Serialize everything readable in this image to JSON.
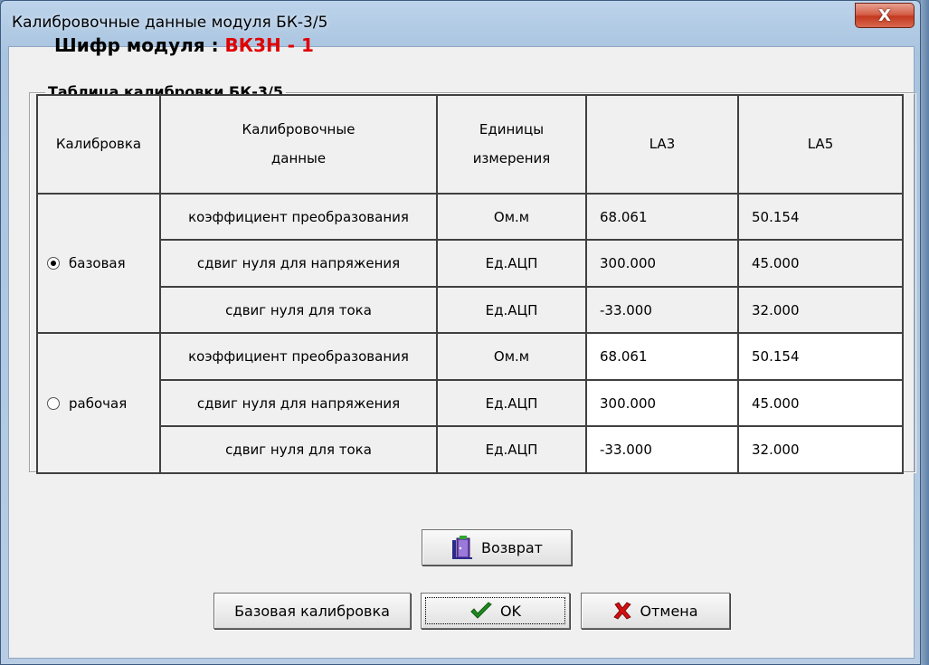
{
  "window": {
    "title": "Калибровочные данные модуля БК-3/5",
    "close_glyph": "X"
  },
  "cipher": {
    "label": "Шифр модуля : ",
    "value": "ВК3Н - 1",
    "value_color": "#e00000"
  },
  "group": {
    "title": "Таблица калибровки БК-3/5"
  },
  "table": {
    "headers": {
      "calibration": "Калибровка",
      "data_line1": "Калибровочные",
      "data_line2": "данные",
      "units_line1": "Единицы",
      "units_line2": "измерения",
      "la3": "LA3",
      "la5": "LA5"
    },
    "groups": [
      {
        "radio_label": "базовая",
        "selected": true,
        "rows": [
          {
            "name": "коэффициент преобразования",
            "unit": "Ом.м",
            "la3": "68.061",
            "la5": "50.154"
          },
          {
            "name": "сдвиг нуля для напряжения",
            "unit": "Ед.АЦП",
            "la3": "300.000",
            "la5": "45.000"
          },
          {
            "name": "сдвиг нуля для тока",
            "unit": "Ед.АЦП",
            "la3": "-33.000",
            "la5": "32.000"
          }
        ]
      },
      {
        "radio_label": "рабочая",
        "selected": false,
        "rows": [
          {
            "name": "коэффициент преобразования",
            "unit": "Ом.м",
            "la3": "68.061",
            "la5": "50.154"
          },
          {
            "name": "сдвиг нуля для напряжения",
            "unit": "Ед.АЦП",
            "la3": "300.000",
            "la5": "45.000"
          },
          {
            "name": "сдвиг нуля для тока",
            "unit": "Ед.АЦП",
            "la3": "-33.000",
            "la5": "32.000"
          }
        ]
      }
    ]
  },
  "buttons": {
    "return_label": "Возврат",
    "base_calibration_label": "Базовая калибровка",
    "ok_label": "OK",
    "cancel_label": "Отмена",
    "ok_icon": "checkmark-icon",
    "cancel_icon": "red-x-icon",
    "return_icon": "door-exit-icon"
  }
}
